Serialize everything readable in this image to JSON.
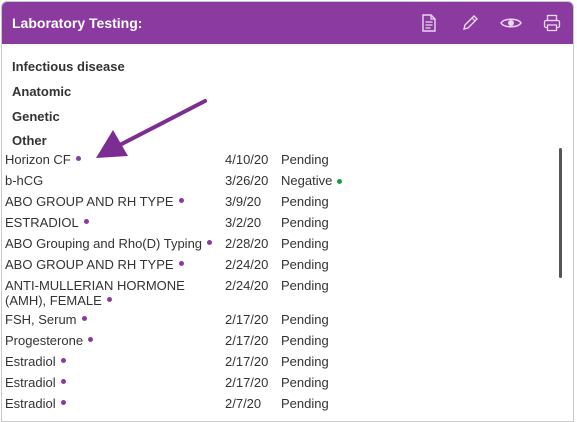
{
  "panel": {
    "title": "Laboratory Testing:",
    "icons": [
      "document-icon",
      "pencil-icon",
      "eye-icon",
      "printer-icon"
    ]
  },
  "sections": [
    "Infectious disease",
    "Anatomic",
    "Genetic",
    "Other"
  ],
  "rows": [
    {
      "name": "Horizon CF",
      "date": "4/10/20",
      "result": "Pending",
      "dot": "purple"
    },
    {
      "name": "b-hCG",
      "date": "3/26/20",
      "result": "Negative",
      "dot": "green-after-result"
    },
    {
      "name": "ABO GROUP AND RH TYPE",
      "date": "3/9/20",
      "result": "Pending",
      "dot": "purple"
    },
    {
      "name": "ESTRADIOL",
      "date": "3/2/20",
      "result": "Pending",
      "dot": "purple"
    },
    {
      "name": "ABO Grouping and Rho(D) Typing",
      "date": "2/28/20",
      "result": "Pending",
      "dot": "purple"
    },
    {
      "name": "ABO GROUP AND RH TYPE",
      "date": "2/24/20",
      "result": "Pending",
      "dot": "purple"
    },
    {
      "name": "ANTI-MULLERIAN HORMONE (AMH), FEMALE",
      "date": "2/24/20",
      "result": "Pending",
      "dot": "purple"
    },
    {
      "name": "FSH, Serum",
      "date": "2/17/20",
      "result": "Pending",
      "dot": "purple"
    },
    {
      "name": "Progesterone",
      "date": "2/17/20",
      "result": "Pending",
      "dot": "purple"
    },
    {
      "name": "Estradiol",
      "date": "2/17/20",
      "result": "Pending",
      "dot": "purple"
    },
    {
      "name": "Estradiol",
      "date": "2/17/20",
      "result": "Pending",
      "dot": "purple"
    },
    {
      "name": "Estradiol",
      "date": "2/7/20",
      "result": "Pending",
      "dot": "purple"
    }
  ],
  "colors": {
    "header": "#8b3aa0",
    "arrow": "#7b2d91",
    "negative_dot": "#1a9a4a"
  }
}
